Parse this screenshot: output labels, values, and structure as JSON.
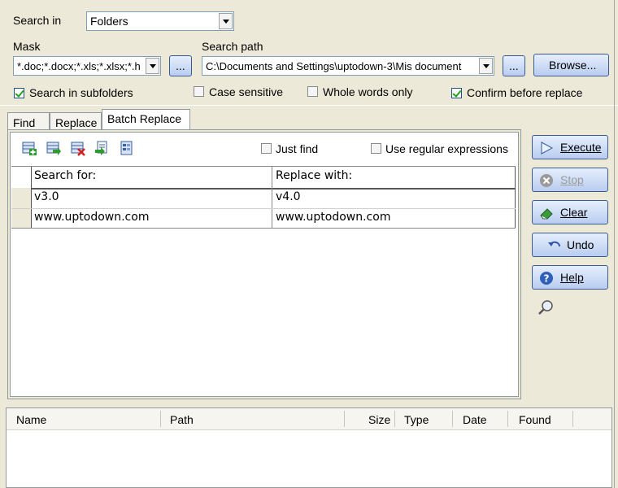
{
  "search_in": {
    "label": "Search in",
    "value": "Folders"
  },
  "mask": {
    "label": "Mask",
    "value": "*.doc;*.docx;*.xls;*.xlsx;*.h",
    "browse_label": "..."
  },
  "search_path": {
    "label": "Search path",
    "value": "C:\\Documents and Settings\\uptodown-3\\Mis document",
    "ellipsis_label": "...",
    "browse_label": "Browse..."
  },
  "options": {
    "subfolders": {
      "label": "Search in subfolders",
      "checked": true
    },
    "case_sensitive": {
      "label": "Case sensitive",
      "checked": false
    },
    "whole_words": {
      "label": "Whole words only",
      "checked": false
    },
    "confirm_replace": {
      "label": "Confirm before replace",
      "checked": true
    }
  },
  "tabs": [
    {
      "label": "Find",
      "active": false
    },
    {
      "label": "Replace",
      "active": false
    },
    {
      "label": "Batch Replace",
      "active": true
    }
  ],
  "batch": {
    "just_find": {
      "label": "Just find",
      "checked": false
    },
    "regex": {
      "label": "Use regular expressions",
      "checked": false
    },
    "columns": {
      "search": "Search for:",
      "replace": "Replace with:"
    },
    "rows": [
      {
        "search": "v3.0",
        "replace": "v4.0"
      },
      {
        "search": "www.uptodown.com",
        "replace": "www.uptodown.com"
      }
    ]
  },
  "actions": {
    "execute": "Execute",
    "stop": "Stop",
    "clear": "Clear",
    "undo": "Undo",
    "help": "Help"
  },
  "results": {
    "columns": {
      "name": "Name",
      "path": "Path",
      "size": "Size",
      "type": "Type",
      "date": "Date",
      "found": "Found"
    }
  },
  "colors": {
    "window": "#ECE9D8",
    "accent": "#316AC5"
  }
}
